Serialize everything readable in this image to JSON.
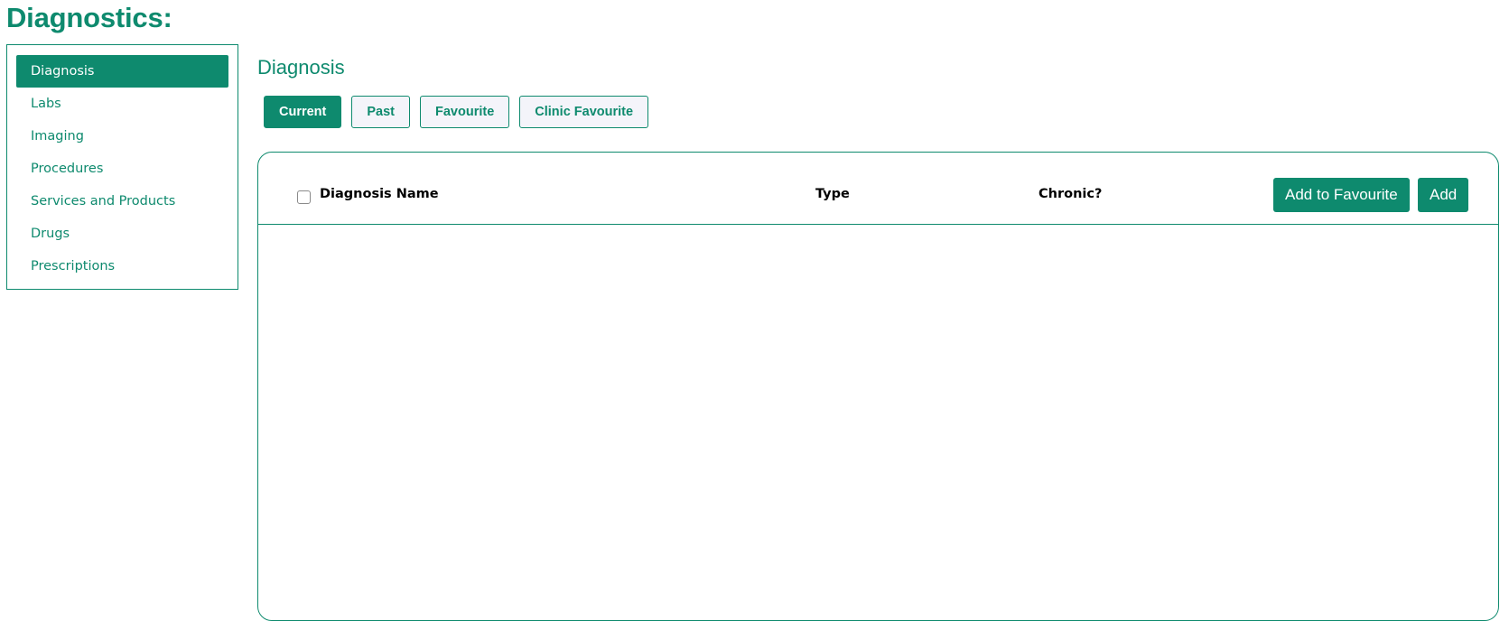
{
  "page": {
    "title": "Diagnostics:"
  },
  "sidebar": {
    "items": [
      {
        "label": "Diagnosis",
        "active": true
      },
      {
        "label": "Labs"
      },
      {
        "label": "Imaging"
      },
      {
        "label": "Procedures"
      },
      {
        "label": "Services and Products"
      },
      {
        "label": "Drugs"
      },
      {
        "label": "Prescriptions"
      }
    ]
  },
  "main": {
    "title": "Diagnosis",
    "tabs": [
      {
        "label": "Current",
        "active": true
      },
      {
        "label": "Past"
      },
      {
        "label": "Favourite"
      },
      {
        "label": "Clinic Favourite"
      }
    ],
    "table": {
      "columns": {
        "name": "Diagnosis Name",
        "type": "Type",
        "chronic": "Chronic?"
      },
      "rows": []
    },
    "actions": {
      "add_to_favourite": "Add to Favourite",
      "add": "Add"
    }
  },
  "colors": {
    "accent": "#0e8a6e",
    "tab_background": "#f4f4fa"
  }
}
